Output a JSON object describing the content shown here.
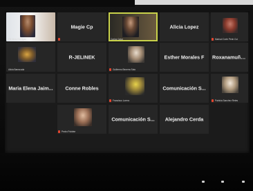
{
  "window": {
    "app": "Zoom"
  },
  "participants": [
    {
      "id": "p1",
      "name": "",
      "caption": "Pili Nieto Escrigas",
      "video": true
    },
    {
      "id": "p2",
      "name": "Magie Cp",
      "caption": "",
      "video": false
    },
    {
      "id": "p3",
      "name": "",
      "caption": "Carlos Calvo",
      "video": true,
      "active": true
    },
    {
      "id": "p4",
      "name": "Alicia Lopez",
      "caption": "",
      "video": false
    },
    {
      "id": "p5",
      "name": "",
      "caption": "Marisol Corte Perin Cui",
      "video": true
    },
    {
      "id": "p6",
      "name": "",
      "caption": "Alicia Barracuda",
      "video": true
    },
    {
      "id": "p7",
      "name": "R-JELINEK",
      "caption": "",
      "video": false
    },
    {
      "id": "p8",
      "name": "",
      "caption": "Guillermo Becerra Soto",
      "video": true
    },
    {
      "id": "p9",
      "name": "Esther Morales F",
      "caption": "",
      "video": false
    },
    {
      "id": "p10",
      "name": "Roxanamuñoz_H...",
      "caption": "",
      "video": false
    },
    {
      "id": "p11",
      "name": "Maria Elena Jaim...",
      "caption": "",
      "video": false
    },
    {
      "id": "p12",
      "name": "Conne Robles",
      "caption": "",
      "video": false
    },
    {
      "id": "p13",
      "name": "",
      "caption": "Francisco Lorenz",
      "video": true
    },
    {
      "id": "p14",
      "name": "Comunicación S...",
      "caption": "",
      "video": false
    },
    {
      "id": "p15",
      "name": "",
      "caption": "Patricia Sanchez Retes",
      "video": true
    },
    {
      "id": "p16",
      "name": "",
      "caption": "Pedro Poblete",
      "video": true
    },
    {
      "id": "p17",
      "name": "Comunicación S...",
      "caption": "",
      "video": false
    },
    {
      "id": "p18",
      "name": "Alejandro Cerda",
      "caption": "",
      "video": false
    }
  ],
  "colors": {
    "active_border": "#c9d24a",
    "mic_muted": "#e2452f",
    "tile_bg": "#262626"
  }
}
